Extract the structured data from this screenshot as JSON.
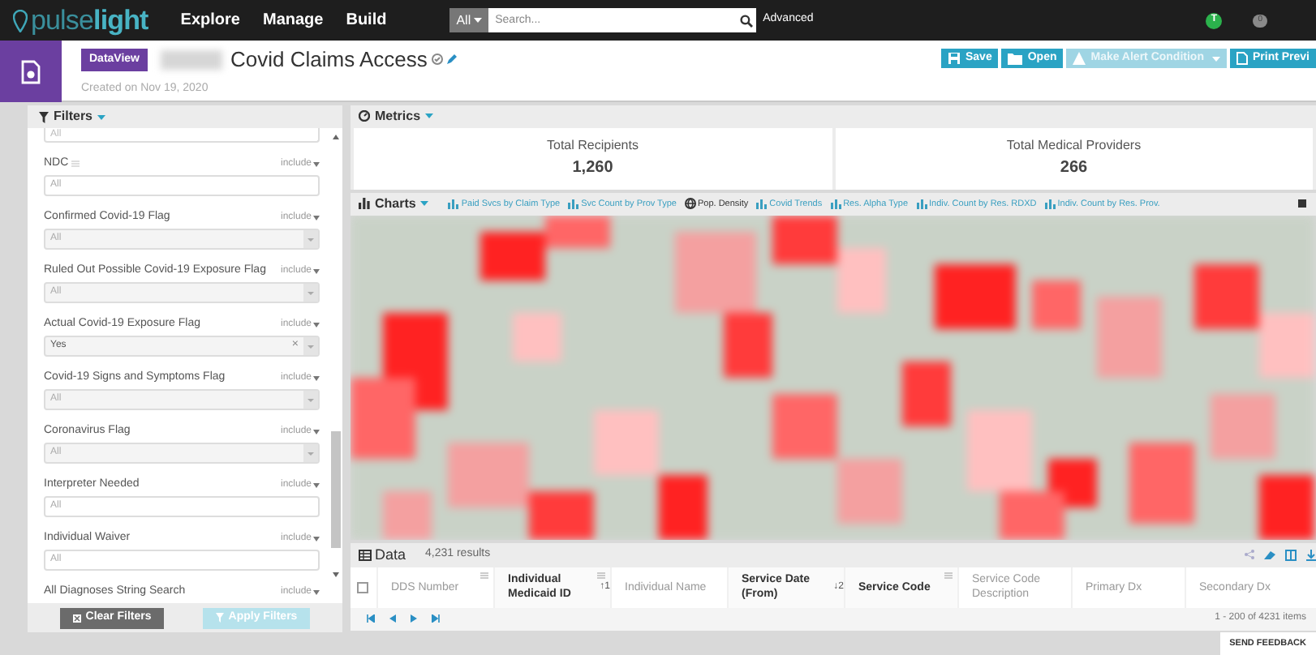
{
  "topbar": {
    "logo": {
      "part1": "pulse",
      "part2": "light"
    },
    "nav": [
      {
        "label": "Explore"
      },
      {
        "label": "Manage"
      },
      {
        "label": "Build"
      }
    ],
    "search": {
      "scope": "All",
      "placeholder": "Search...",
      "advanced": "Advanced"
    },
    "user_badge": "T",
    "notification_count": "0"
  },
  "header": {
    "badge": "DataView",
    "title": "Covid Claims Access",
    "created": "Created on Nov 19, 2020",
    "buttons": [
      {
        "label": "Save",
        "disabled": false
      },
      {
        "label": "Open",
        "disabled": false
      },
      {
        "label": "Make Alert Condition",
        "disabled": true
      },
      {
        "label": "Print Previ",
        "disabled": false
      }
    ]
  },
  "filters": {
    "title": "Filters",
    "partial_placeholder": "All",
    "items": [
      {
        "label": "NDC",
        "kind": "text",
        "mode": "include",
        "placeholder": "All",
        "menu": true
      },
      {
        "label": "Confirmed Covid-19 Flag",
        "kind": "select",
        "mode": "include",
        "placeholder": "All",
        "menu": false
      },
      {
        "label": "Ruled Out Possible Covid-19 Exposure Flag",
        "kind": "select",
        "mode": "include",
        "placeholder": "All",
        "menu": false
      },
      {
        "label": "Actual Covid-19 Exposure Flag",
        "kind": "select",
        "mode": "include",
        "value": "Yes",
        "clear_symbol": "×",
        "menu": false
      },
      {
        "label": "Covid-19 Signs and Symptoms Flag",
        "kind": "select",
        "mode": "include",
        "placeholder": "All",
        "menu": false
      },
      {
        "label": "Coronavirus Flag",
        "kind": "select",
        "mode": "include",
        "placeholder": "All",
        "menu": false
      },
      {
        "label": "Interpreter Needed",
        "kind": "text",
        "mode": "include",
        "placeholder": "All",
        "menu": false
      },
      {
        "label": "Individual Waiver",
        "kind": "text",
        "mode": "include",
        "placeholder": "All",
        "menu": false
      },
      {
        "label": "All Diagnoses String Search",
        "kind": "label",
        "mode": "include",
        "menu": false
      }
    ],
    "clear_button": {
      "label": "Clear Filters",
      "disabled": false
    },
    "apply_button": {
      "label": "Apply Filters",
      "disabled": true
    }
  },
  "metrics": {
    "title": "Metrics",
    "cards": [
      {
        "label": "Total Recipients",
        "value": "1,260"
      },
      {
        "label": "Total Medical Providers",
        "value": "266"
      }
    ]
  },
  "charts": {
    "title": "Charts",
    "tabs": [
      {
        "label": "Paid Svcs by Claim Type",
        "kind": "bar",
        "selected": false
      },
      {
        "label": "Svc Count by Prov Type",
        "kind": "bar",
        "selected": false
      },
      {
        "label": "Pop. Density",
        "kind": "map",
        "selected": true
      },
      {
        "label": "Covid Trends",
        "kind": "bar",
        "selected": false
      },
      {
        "label": "Res. Alpha Type",
        "kind": "bar",
        "selected": false
      },
      {
        "label": "Indiv. Count by Res. RDXD",
        "kind": "bar",
        "selected": false
      },
      {
        "label": "Indiv. Count by Res. Prov.",
        "kind": "bar",
        "selected": false
      }
    ]
  },
  "data": {
    "title": "Data",
    "results": "4,231 results",
    "columns": [
      {
        "label": "DDS Number",
        "bold": false,
        "menu": true
      },
      {
        "label": "Individual Medicaid ID",
        "bold": true,
        "sort": "↑1",
        "menu": true
      },
      {
        "label": "Individual Name",
        "bold": false,
        "menu": false
      },
      {
        "label": "Service Date (From)",
        "bold": true,
        "sort": "↓2",
        "menu": false
      },
      {
        "label": "Service Code",
        "bold": true,
        "menu": true
      },
      {
        "label": "Service Code Description",
        "bold": false,
        "menu": false
      },
      {
        "label": "Primary Dx",
        "bold": false,
        "menu": false
      },
      {
        "label": "Secondary Dx",
        "bold": false,
        "menu": false
      }
    ],
    "pager_info": "1 - 200 of 4231 items"
  },
  "feedback": "SEND FEEDBACK"
}
